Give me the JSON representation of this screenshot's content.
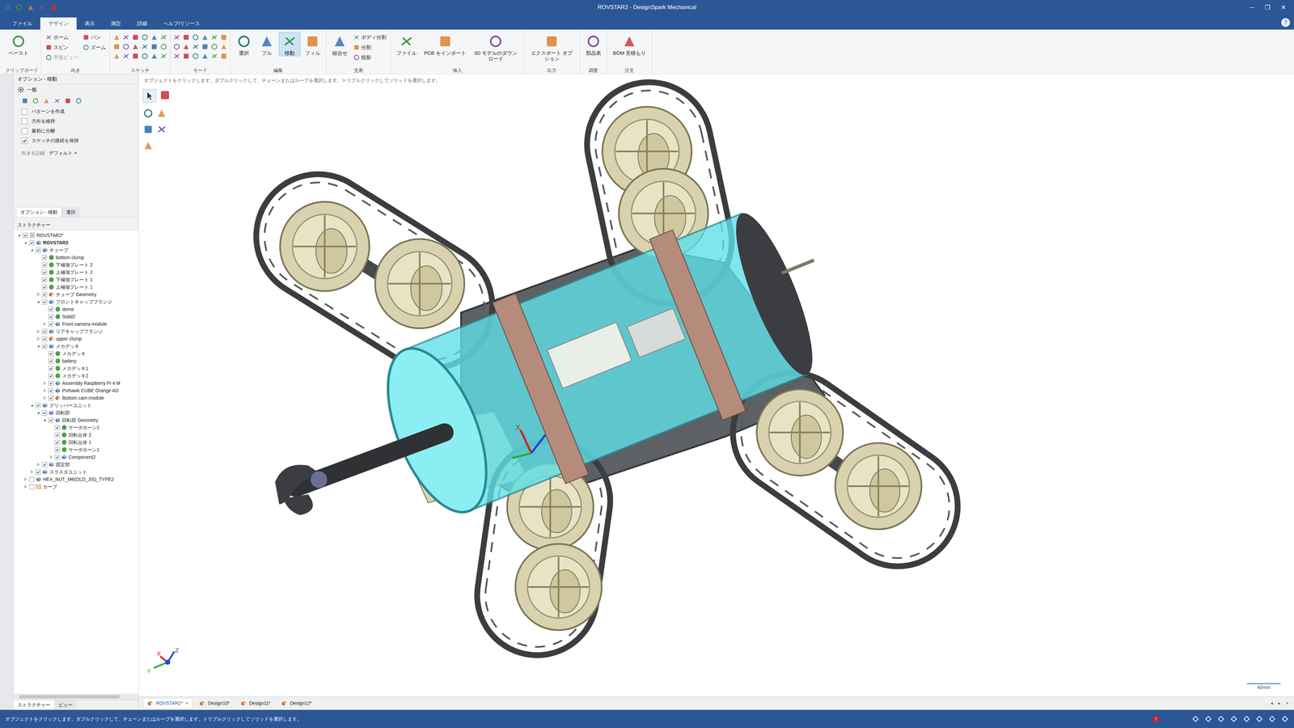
{
  "window": {
    "title": "ROVSTAR2 - DesignSpark Mechanical",
    "controls": [
      "─",
      "❐",
      "✕"
    ]
  },
  "menu_tabs": [
    {
      "label": "ファイル",
      "selected": false
    },
    {
      "label": "デザイン",
      "selected": true
    },
    {
      "label": "表示",
      "selected": false
    },
    {
      "label": "測定",
      "selected": false
    },
    {
      "label": "詳細",
      "selected": false
    },
    {
      "label": "ヘルプ/リソース",
      "selected": false
    }
  ],
  "help": "?",
  "ribbon": {
    "groups": [
      {
        "label": "クリップボード",
        "tools": [
          {
            "label": "ペースト",
            "kind": "large",
            "selected": false,
            "disabled": false
          }
        ]
      },
      {
        "label": "向き",
        "tools": [
          {
            "label": "ホーム",
            "kind": "small",
            "selected": false,
            "disabled": false
          },
          {
            "label": "スピン",
            "kind": "small",
            "selected": false,
            "disabled": false
          },
          {
            "label": "平面ビュー",
            "kind": "small",
            "selected": false,
            "disabled": true
          },
          {
            "label": "パン",
            "kind": "small",
            "selected": false,
            "disabled": false
          },
          {
            "label": "ズーム",
            "kind": "small",
            "selected": false,
            "disabled": false
          }
        ]
      },
      {
        "label": "スケッチ",
        "tools": []
      },
      {
        "label": "モード",
        "tools": []
      },
      {
        "label": "編集",
        "tools": [
          {
            "label": "選択",
            "kind": "large",
            "selected": false,
            "disabled": false
          },
          {
            "label": "プル",
            "kind": "large",
            "selected": false,
            "disabled": false
          },
          {
            "label": "移動",
            "kind": "large",
            "selected": true,
            "disabled": false
          },
          {
            "label": "フィル",
            "kind": "large",
            "selected": false,
            "disabled": false
          }
        ]
      },
      {
        "label": "交差",
        "tools": [
          {
            "label": "組合せ",
            "kind": "large",
            "selected": false,
            "disabled": false
          },
          {
            "label": "ボディ分割",
            "kind": "small",
            "selected": false,
            "disabled": false
          },
          {
            "label": "分割",
            "kind": "small",
            "selected": false,
            "disabled": false
          },
          {
            "label": "投影",
            "kind": "small",
            "selected": false,
            "disabled": false
          }
        ]
      },
      {
        "label": "挿入",
        "tools": [
          {
            "label": "ファイル",
            "kind": "large",
            "selected": false,
            "disabled": false
          },
          {
            "label": "PCB をインポート",
            "kind": "large",
            "selected": false,
            "disabled": false
          },
          {
            "label": "3D モデルのダウンロード",
            "kind": "large",
            "selected": false,
            "disabled": false
          }
        ]
      },
      {
        "label": "出力",
        "tools": [
          {
            "label": "エクスポート オプション",
            "kind": "large",
            "selected": false,
            "disabled": false
          }
        ]
      },
      {
        "label": "調査",
        "tools": [
          {
            "label": "部品表",
            "kind": "large",
            "selected": false,
            "disabled": false
          }
        ]
      },
      {
        "label": "注文",
        "tools": [
          {
            "label": "BOM 見積もり",
            "kind": "large",
            "selected": false,
            "disabled": false
          }
        ]
      }
    ]
  },
  "options_panel": {
    "title": "オプション - 移動",
    "section": "一般",
    "checkboxes": [
      {
        "label": "パターンを作成",
        "checked": false
      },
      {
        "label": "方向を維持",
        "checked": false
      },
      {
        "label": "最初に分離",
        "checked": false
      },
      {
        "label": "スケッチの接続を保持",
        "checked": true
      }
    ],
    "orientation_label": "向きを記録",
    "orientation_value": "デフォルト"
  },
  "panel_tabs": [
    {
      "label": "オプション - 移動",
      "selected": true
    },
    {
      "label": "選択",
      "selected": false
    }
  ],
  "structure": {
    "title": "ストラクチャー",
    "items": [
      {
        "label": "ROVSTAR2*",
        "level": 0,
        "expandable": true,
        "expanded": true,
        "checked": true,
        "kind": "doc"
      },
      {
        "label": "ROVSTAR2",
        "level": 1,
        "expandable": true,
        "expanded": true,
        "checked": true,
        "kind": "assembly"
      },
      {
        "label": "チューブ",
        "level": 2,
        "expandable": true,
        "expanded": true,
        "checked": true,
        "kind": "assembly"
      },
      {
        "label": "bottom clump",
        "level": 3,
        "expandable": false,
        "expanded": false,
        "checked": true,
        "kind": "body"
      },
      {
        "label": "下補強プレート 2",
        "level": 3,
        "expandable": false,
        "expanded": false,
        "checked": true,
        "kind": "body"
      },
      {
        "label": "上補強プレート 2",
        "level": 3,
        "expandable": false,
        "expanded": false,
        "checked": true,
        "kind": "body"
      },
      {
        "label": "下補強プレート 1",
        "level": 3,
        "expandable": false,
        "expanded": false,
        "checked": true,
        "kind": "body"
      },
      {
        "label": "上補強プレート 1",
        "level": 3,
        "expandable": false,
        "expanded": false,
        "checked": true,
        "kind": "body"
      },
      {
        "label": "チューブ Geometry",
        "level": 3,
        "expandable": true,
        "expanded": false,
        "checked": true,
        "kind": "component"
      },
      {
        "label": "フロントキャップフランジ",
        "level": 3,
        "expandable": true,
        "expanded": true,
        "checked": true,
        "kind": "assembly"
      },
      {
        "label": "dome",
        "level": 4,
        "expandable": false,
        "expanded": false,
        "checked": true,
        "kind": "body"
      },
      {
        "label": "Solid2",
        "level": 4,
        "expandable": false,
        "expanded": false,
        "checked": true,
        "kind": "body"
      },
      {
        "label": "Front camera module",
        "level": 4,
        "expandable": true,
        "expanded": false,
        "checked": true,
        "kind": "assembly"
      },
      {
        "label": "リアキャップフランジ",
        "level": 3,
        "expandable": true,
        "expanded": false,
        "checked": true,
        "kind": "assembly"
      },
      {
        "label": "upper clump",
        "level": 3,
        "expandable": true,
        "expanded": false,
        "checked": true,
        "kind": "component"
      },
      {
        "label": "メカデッキ",
        "level": 3,
        "expandable": true,
        "expanded": true,
        "checked": true,
        "kind": "assembly"
      },
      {
        "label": "メカデッキ",
        "level": 4,
        "expandable": false,
        "expanded": false,
        "checked": true,
        "kind": "body"
      },
      {
        "label": "battery",
        "level": 4,
        "expandable": false,
        "expanded": false,
        "checked": true,
        "kind": "body"
      },
      {
        "label": "メカデッキ1",
        "level": 4,
        "expandable": false,
        "expanded": false,
        "checked": true,
        "kind": "body"
      },
      {
        "label": "メカデッキ2",
        "level": 4,
        "expandable": false,
        "expanded": false,
        "checked": true,
        "kind": "body"
      },
      {
        "label": "Assembly Raspberry Pi 4 M",
        "level": 4,
        "expandable": true,
        "expanded": false,
        "checked": true,
        "kind": "assembly"
      },
      {
        "label": "Pixhawk CUBE Orange AD",
        "level": 4,
        "expandable": true,
        "expanded": false,
        "checked": true,
        "kind": "assembly"
      },
      {
        "label": "Bottom cam module",
        "level": 4,
        "expandable": true,
        "expanded": false,
        "checked": true,
        "kind": "component"
      },
      {
        "label": "グリッパーユニット",
        "level": 2,
        "expandable": true,
        "expanded": true,
        "checked": true,
        "kind": "assembly"
      },
      {
        "label": "回転部",
        "level": 3,
        "expandable": true,
        "expanded": true,
        "checked": true,
        "kind": "assembly"
      },
      {
        "label": "回転部 Geometry",
        "level": 4,
        "expandable": true,
        "expanded": true,
        "checked": true,
        "kind": "assembly"
      },
      {
        "label": "サーボホーン2",
        "level": 5,
        "expandable": false,
        "expanded": false,
        "checked": true,
        "kind": "body"
      },
      {
        "label": "回転台座 2",
        "level": 5,
        "expandable": false,
        "expanded": false,
        "checked": true,
        "kind": "body"
      },
      {
        "label": "回転台座 1",
        "level": 5,
        "expandable": false,
        "expanded": false,
        "checked": true,
        "kind": "body"
      },
      {
        "label": "サーボホーン1",
        "level": 5,
        "expandable": false,
        "expanded": false,
        "checked": true,
        "kind": "body"
      },
      {
        "label": "Component2",
        "level": 5,
        "expandable": true,
        "expanded": false,
        "checked": true,
        "kind": "assembly"
      },
      {
        "label": "固定部",
        "level": 3,
        "expandable": true,
        "expanded": false,
        "checked": true,
        "kind": "assembly"
      },
      {
        "label": "スラスタユニット",
        "level": 2,
        "expandable": true,
        "expanded": false,
        "checked": true,
        "kind": "assembly"
      },
      {
        "label": "HEX_NUT_M6(OLD_JIS)_TYPE2",
        "level": 1,
        "expandable": true,
        "expanded": false,
        "checked": false,
        "kind": "assembly"
      },
      {
        "label": "カーブ",
        "level": 1,
        "expandable": true,
        "expanded": false,
        "checked": false,
        "kind": "curve"
      }
    ]
  },
  "bottom_tabs": [
    {
      "label": "ストラクチャー",
      "selected": true
    },
    {
      "label": "ビュー",
      "selected": false
    }
  ],
  "canvas": {
    "hint": "オブジェクトをクリックします。ダブルクリックして、チェーンまたはループを選択します。トリプルクリックしてソリッドを選択します。",
    "scale": "40mm",
    "axis_labels": [
      "Z",
      "X",
      "Y"
    ],
    "origin_label": "X"
  },
  "doc_tabs": [
    {
      "label": "ROVSTAR2*",
      "selected": true,
      "closable": true
    },
    {
      "label": "Design10*",
      "selected": false,
      "closable": false
    },
    {
      "label": "Design11*",
      "selected": false,
      "closable": false
    },
    {
      "label": "Design12*",
      "selected": false,
      "closable": false
    }
  ],
  "doc_tab_close": "×",
  "doc_tab_nav": [
    "◂",
    "▸",
    "×"
  ],
  "status_bar": {
    "text": "オブジェクトをクリックします。ダブルクリックして、チェーンまたはループを選択します。トリプルクリックしてソリッドを選択します。",
    "error_badge": "!"
  }
}
